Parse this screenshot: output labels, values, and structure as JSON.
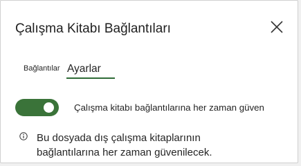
{
  "dialog": {
    "title": "Çalışma Kitabı Bağlantıları",
    "close_icon": "close-icon"
  },
  "tabs": [
    {
      "label": "Bağlantılar",
      "selected": false
    },
    {
      "label": "Ayarlar",
      "selected": true
    }
  ],
  "settings": {
    "toggle_label": "Çalışma kitabı bağlantılarına her zaman güven",
    "toggle_on": true,
    "info_icon": "info-icon",
    "info_text": "Bu dosyada dış çalışma kitaplarının bağlantılarına her zaman güvenilecek."
  },
  "colors": {
    "accent": "#3a7339",
    "tab_underline": "#2f6b36",
    "text": "#242424"
  }
}
